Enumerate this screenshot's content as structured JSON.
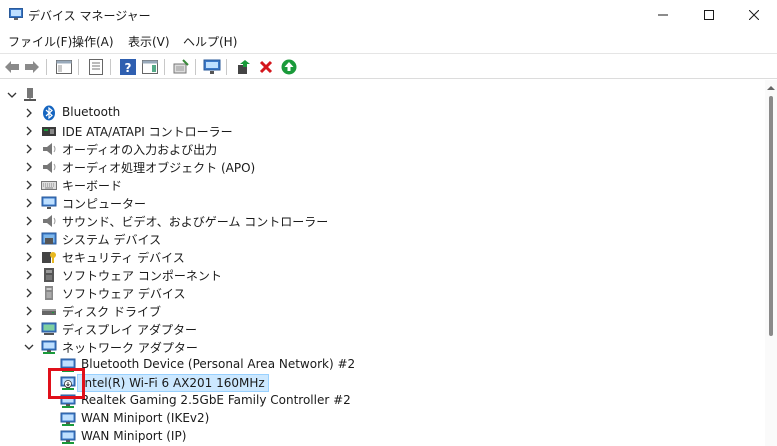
{
  "window": {
    "title": "デバイス マネージャー",
    "controls": [
      "minimize",
      "maximize",
      "close"
    ]
  },
  "menu": [
    "ファイル(F)",
    "操作(A)",
    "表示(V)",
    "ヘルプ(H)"
  ],
  "toolbar": {
    "buttons": [
      "back-arrow-icon",
      "forward-arrow-icon",
      "show-hide-console-tree-icon",
      "properties-icon",
      "help-icon",
      "action-pane-icon",
      "update-driver-icon",
      "scan-hardware-icon",
      "add-legacy-icon",
      "uninstall-icon",
      "enable-device-icon"
    ]
  },
  "tree": {
    "root_label": "",
    "categories": [
      {
        "label": "Bluetooth",
        "icon": "bluetooth-icon",
        "expanded": false
      },
      {
        "label": "IDE ATA/ATAPI コントローラー",
        "icon": "ide-controller-icon",
        "expanded": false
      },
      {
        "label": "オーディオの入力および出力",
        "icon": "speaker-icon",
        "expanded": false
      },
      {
        "label": "オーディオ処理オブジェクト (APO)",
        "icon": "speaker-icon",
        "expanded": false
      },
      {
        "label": "キーボード",
        "icon": "keyboard-icon",
        "expanded": false
      },
      {
        "label": "コンピューター",
        "icon": "computer-icon",
        "expanded": false
      },
      {
        "label": "サウンド、ビデオ、およびゲーム コントローラー",
        "icon": "speaker-icon",
        "expanded": false
      },
      {
        "label": "システム デバイス",
        "icon": "system-device-icon",
        "expanded": false
      },
      {
        "label": "セキュリティ デバイス",
        "icon": "security-key-icon",
        "expanded": false
      },
      {
        "label": "ソフトウェア コンポーネント",
        "icon": "software-component-icon",
        "expanded": false
      },
      {
        "label": "ソフトウェア デバイス",
        "icon": "software-device-icon",
        "expanded": false
      },
      {
        "label": "ディスク ドライブ",
        "icon": "disk-drive-icon",
        "expanded": false
      },
      {
        "label": "ディスプレイ アダプター",
        "icon": "display-adapter-icon",
        "expanded": false
      },
      {
        "label": "ネットワーク アダプター",
        "icon": "network-adapter-icon",
        "expanded": true
      }
    ],
    "network_children": [
      {
        "label": "Bluetooth Device (Personal Area Network) #2",
        "icon": "network-adapter-icon",
        "selected": false
      },
      {
        "label": "Intel(R) Wi-Fi 6 AX201 160MHz",
        "icon": "network-adapter-disabled-icon",
        "selected": true
      },
      {
        "label": "Realtek Gaming 2.5GbE Family Controller #2",
        "icon": "network-adapter-icon",
        "selected": false
      },
      {
        "label": "WAN Miniport (IKEv2)",
        "icon": "network-adapter-icon",
        "selected": false
      },
      {
        "label": "WAN Miniport (IP)",
        "icon": "network-adapter-icon",
        "selected": false
      }
    ]
  },
  "colors": {
    "selection_fill": "#cce8ff",
    "selection_border": "#99d1ff",
    "highlight_box": "#e0101a",
    "uninstall_red": "#d4161c",
    "enable_green": "#1a9a3a"
  }
}
